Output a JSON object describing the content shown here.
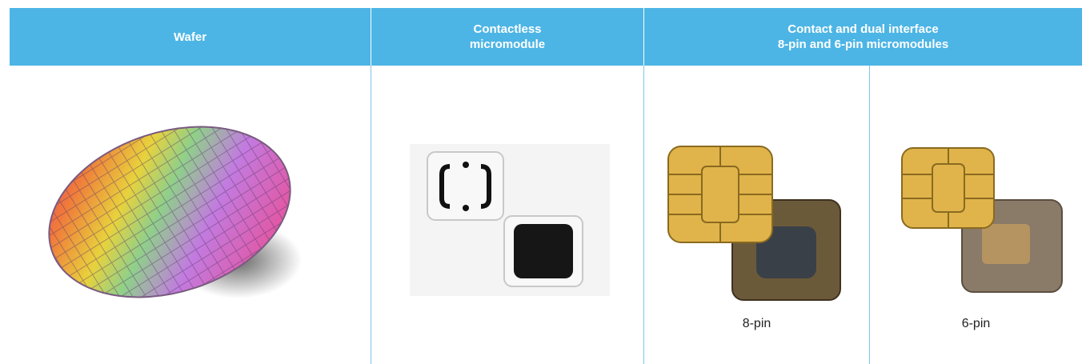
{
  "header": {
    "col1": "Wafer",
    "col2": "Contactless\nmicromodule",
    "col3": "Contact and dual interface\n8-pin and 6-pin micromodules"
  },
  "captions": {
    "pin8": "8-pin",
    "pin6": "6-pin"
  },
  "colors": {
    "header_bg": "#4db5e5",
    "chip_gold": "#e0b44a",
    "divider": "#7cc6ea"
  }
}
